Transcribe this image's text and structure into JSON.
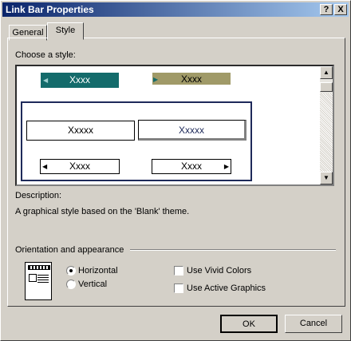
{
  "window": {
    "title": "Link Bar Properties"
  },
  "titlebar": {
    "help": "?",
    "close": "X"
  },
  "tabs": [
    {
      "label": "General"
    },
    {
      "label": "Style"
    }
  ],
  "style_tab": {
    "choose_label": "Choose a style:",
    "samples": {
      "top_left": "Xxxx",
      "top_right": "Xxxx",
      "box_a": "Xxxxx",
      "box_b": "Xxxxx",
      "arrow_left": "Xxxx",
      "arrow_right": "Xxxx"
    },
    "description_label": "Description:",
    "description_text": "A graphical style based on the 'Blank' theme."
  },
  "orientation": {
    "group_label": "Orientation and appearance",
    "horizontal": "Horizontal",
    "vertical": "Vertical",
    "selected": "horizontal",
    "use_vivid_colors": "Use Vivid Colors",
    "use_vivid_colors_checked": false,
    "use_active_graphics": "Use Active Graphics",
    "use_active_graphics_checked": false
  },
  "buttons": {
    "ok": "OK",
    "cancel": "Cancel"
  },
  "colors": {
    "title_start": "#0a246a",
    "title_end": "#a6caf0",
    "teal": "#146b6b",
    "olive": "#a09a68",
    "navy": "#1e2a5a"
  }
}
